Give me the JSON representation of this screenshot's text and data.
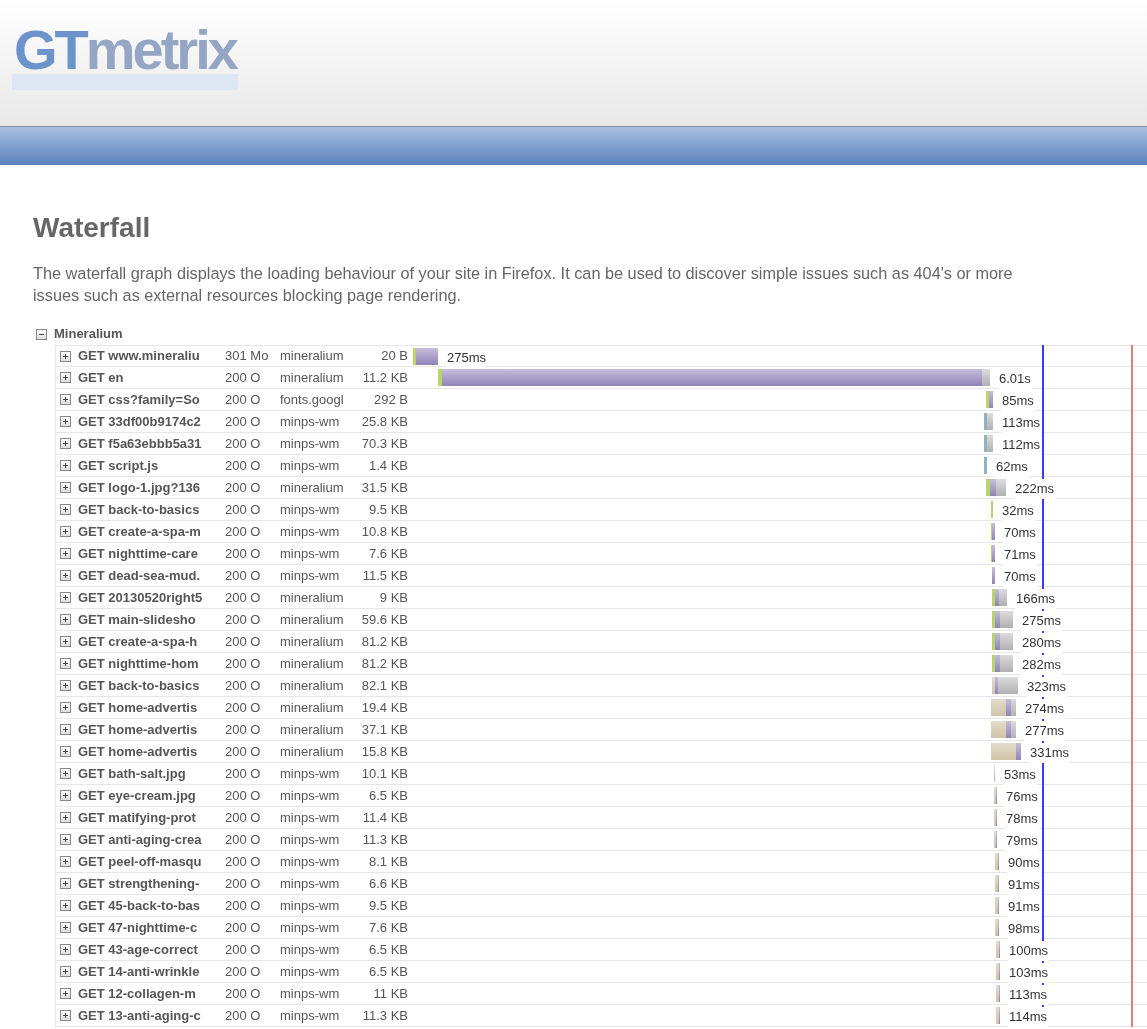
{
  "logo": {
    "parts": [
      {
        "text": "GT"
      },
      {
        "text": "metrix"
      }
    ]
  },
  "heading": "Waterfall",
  "description_lines": [
    "The waterfall graph displays the loading behaviour of your site in Firefox. It can be used to discover simple issues such as 404's or more",
    "issues such as external resources blocking page rendering."
  ],
  "group": {
    "label": "Mineralium",
    "expanded": true
  },
  "rows": [
    {
      "request": "GET www.mineraliu",
      "status": "301 Mo",
      "domain": "mineralium",
      "size": "20 B",
      "duration": "275ms",
      "expanded": false
    },
    {
      "request": "GET en",
      "status": "200 O",
      "domain": "mineralium",
      "size": "11.2 KB",
      "duration": "6.01s",
      "expanded": false
    },
    {
      "request": "GET css?family=So",
      "status": "200 O",
      "domain": "fonts.googl",
      "size": "292 B",
      "duration": "85ms",
      "expanded": false
    },
    {
      "request": "GET 33df00b9174c2",
      "status": "200 O",
      "domain": "minps-wm",
      "size": "25.8 KB",
      "duration": "113ms",
      "expanded": false
    },
    {
      "request": "GET f5a63ebbb5a31",
      "status": "200 O",
      "domain": "minps-wm",
      "size": "70.3 KB",
      "duration": "112ms",
      "expanded": false
    },
    {
      "request": "GET script.js",
      "status": "200 O",
      "domain": "minps-wm",
      "size": "1.4 KB",
      "duration": "62ms",
      "expanded": false
    },
    {
      "request": "GET logo-1.jpg?136",
      "status": "200 O",
      "domain": "mineralium",
      "size": "31.5 KB",
      "duration": "222ms",
      "expanded": false
    },
    {
      "request": "GET back-to-basics",
      "status": "200 O",
      "domain": "minps-wm",
      "size": "9.5 KB",
      "duration": "32ms",
      "expanded": false
    },
    {
      "request": "GET create-a-spa-m",
      "status": "200 O",
      "domain": "minps-wm",
      "size": "10.8 KB",
      "duration": "70ms",
      "expanded": false
    },
    {
      "request": "GET nighttime-care",
      "status": "200 O",
      "domain": "minps-wm",
      "size": "7.6 KB",
      "duration": "71ms",
      "expanded": false
    },
    {
      "request": "GET dead-sea-mud.",
      "status": "200 O",
      "domain": "minps-wm",
      "size": "11.5 KB",
      "duration": "70ms",
      "expanded": false
    },
    {
      "request": "GET 20130520right5",
      "status": "200 O",
      "domain": "mineralium",
      "size": "9 KB",
      "duration": "166ms",
      "expanded": false
    },
    {
      "request": "GET main-slidesho",
      "status": "200 O",
      "domain": "mineralium",
      "size": "59.6 KB",
      "duration": "275ms",
      "expanded": false
    },
    {
      "request": "GET create-a-spa-h",
      "status": "200 O",
      "domain": "mineralium",
      "size": "81.2 KB",
      "duration": "280ms",
      "expanded": false
    },
    {
      "request": "GET nighttime-hom",
      "status": "200 O",
      "domain": "mineralium",
      "size": "81.2 KB",
      "duration": "282ms",
      "expanded": false
    },
    {
      "request": "GET back-to-basics",
      "status": "200 O",
      "domain": "mineralium",
      "size": "82.1 KB",
      "duration": "323ms",
      "expanded": false
    },
    {
      "request": "GET home-advertis",
      "status": "200 O",
      "domain": "mineralium",
      "size": "19.4 KB",
      "duration": "274ms",
      "expanded": false
    },
    {
      "request": "GET home-advertis",
      "status": "200 O",
      "domain": "mineralium",
      "size": "37.1 KB",
      "duration": "277ms",
      "expanded": false
    },
    {
      "request": "GET home-advertis",
      "status": "200 O",
      "domain": "mineralium",
      "size": "15.8 KB",
      "duration": "331ms",
      "expanded": false
    },
    {
      "request": "GET bath-salt.jpg",
      "status": "200 O",
      "domain": "minps-wm",
      "size": "10.1 KB",
      "duration": "53ms",
      "expanded": false
    },
    {
      "request": "GET eye-cream.jpg",
      "status": "200 O",
      "domain": "minps-wm",
      "size": "6.5 KB",
      "duration": "76ms",
      "expanded": false
    },
    {
      "request": "GET matifying-prot",
      "status": "200 O",
      "domain": "minps-wm",
      "size": "11.4 KB",
      "duration": "78ms",
      "expanded": false
    },
    {
      "request": "GET anti-aging-crea",
      "status": "200 O",
      "domain": "minps-wm",
      "size": "11.3 KB",
      "duration": "79ms",
      "expanded": false
    },
    {
      "request": "GET peel-off-masqu",
      "status": "200 O",
      "domain": "minps-wm",
      "size": "8.1 KB",
      "duration": "90ms",
      "expanded": false
    },
    {
      "request": "GET strengthening-",
      "status": "200 O",
      "domain": "minps-wm",
      "size": "6.6 KB",
      "duration": "91ms",
      "expanded": false
    },
    {
      "request": "GET 45-back-to-bas",
      "status": "200 O",
      "domain": "minps-wm",
      "size": "9.5 KB",
      "duration": "91ms",
      "expanded": false
    },
    {
      "request": "GET 47-nighttime-c",
      "status": "200 O",
      "domain": "minps-wm",
      "size": "7.6 KB",
      "duration": "98ms",
      "expanded": false
    },
    {
      "request": "GET 43-age-correct",
      "status": "200 O",
      "domain": "minps-wm",
      "size": "6.5 KB",
      "duration": "100ms",
      "expanded": false
    },
    {
      "request": "GET 14-anti-wrinkle",
      "status": "200 O",
      "domain": "minps-wm",
      "size": "6.5 KB",
      "duration": "103ms",
      "expanded": false
    },
    {
      "request": "GET 12-collagen-m",
      "status": "200 O",
      "domain": "minps-wm",
      "size": "11 KB",
      "duration": "113ms",
      "expanded": false
    },
    {
      "request": "GET 13-anti-aging-c",
      "status": "200 O",
      "domain": "minps-wm",
      "size": "11.3 KB",
      "duration": "114ms",
      "expanded": false
    }
  ]
}
